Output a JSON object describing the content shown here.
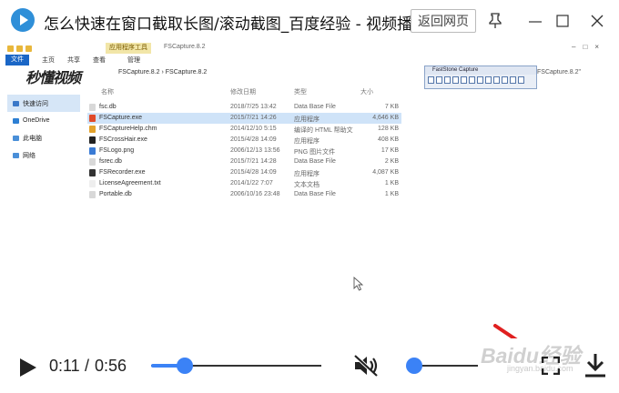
{
  "window": {
    "title": "怎么快速在窗口截取长图/滚动截图_百度经验 - 视频播放器",
    "back_label": "返回网页"
  },
  "explorer": {
    "context_tab": "应用程序工具",
    "small_path": "FSCapture.8.2",
    "ribbon_tabs": [
      "文件",
      "主页",
      "共享",
      "查看",
      "管理"
    ],
    "watermark_logo": "秒懂视频",
    "address_path": "FSCapture.8.2  ›  FSCapture.8.2",
    "address_right": "FSCapture.8.2\"",
    "toolbar_title": "FastStone Capture",
    "columns": {
      "name": "名称",
      "date": "修改日期",
      "type": "类型",
      "size": "大小"
    },
    "nav": [
      {
        "label": "快速访问",
        "icon": "star-icon",
        "color": "#3a78c8"
      },
      {
        "label": "OneDrive",
        "icon": "cloud-icon",
        "color": "#2d7fd3"
      },
      {
        "label": "此电脑",
        "icon": "computer-icon",
        "color": "#4a8fd8"
      },
      {
        "label": "网络",
        "icon": "network-icon",
        "color": "#4a8fd8"
      }
    ],
    "files": [
      {
        "name": "fsc.db",
        "date": "2018/7/25 13:42",
        "type": "Data Base File",
        "size": "7 KB",
        "icon": "db-file-icon",
        "color": "#d8d8d8"
      },
      {
        "name": "FSCapture.exe",
        "date": "2015/7/21 14:26",
        "type": "应用程序",
        "size": "4,646 KB",
        "icon": "app-exe-icon",
        "color": "#e04a2a"
      },
      {
        "name": "FSCaptureHelp.chm",
        "date": "2014/12/10 5:15",
        "type": "编译的 HTML 帮助文",
        "size": "128 KB",
        "icon": "help-file-icon",
        "color": "#e3a22b"
      },
      {
        "name": "FSCrossHair.exe",
        "date": "2015/4/28 14:09",
        "type": "应用程序",
        "size": "408 KB",
        "icon": "crosshair-icon",
        "color": "#222222"
      },
      {
        "name": "FSLogo.png",
        "date": "2006/12/13 13:56",
        "type": "PNG 图片文件",
        "size": "17 KB",
        "icon": "image-file-icon",
        "color": "#3a7bd5"
      },
      {
        "name": "fsrec.db",
        "date": "2015/7/21 14:28",
        "type": "Data Base File",
        "size": "2 KB",
        "icon": "db-file-icon",
        "color": "#d8d8d8"
      },
      {
        "name": "FSRecorder.exe",
        "date": "2015/4/28 14:09",
        "type": "应用程序",
        "size": "4,087 KB",
        "icon": "recorder-icon",
        "color": "#333333"
      },
      {
        "name": "LicenseAgreement.txt",
        "date": "2014/1/22 7:07",
        "type": "文本文档",
        "size": "1 KB",
        "icon": "text-file-icon",
        "color": "#eeeeee"
      },
      {
        "name": "Portable.db",
        "date": "2006/10/16 23:48",
        "type": "Data Base File",
        "size": "1 KB",
        "icon": "db-file-icon",
        "color": "#d8d8d8"
      }
    ],
    "selected_file_index": 1
  },
  "player": {
    "current_time": "0:11",
    "separator": "/",
    "total_time": "0:56",
    "progress_fraction": 0.196,
    "volume_fraction": 0.0,
    "muted": true,
    "accent_color": "#3b82f6",
    "watermark": "Baidu经验",
    "watermark_sub": "jingyan.baidu.com"
  }
}
